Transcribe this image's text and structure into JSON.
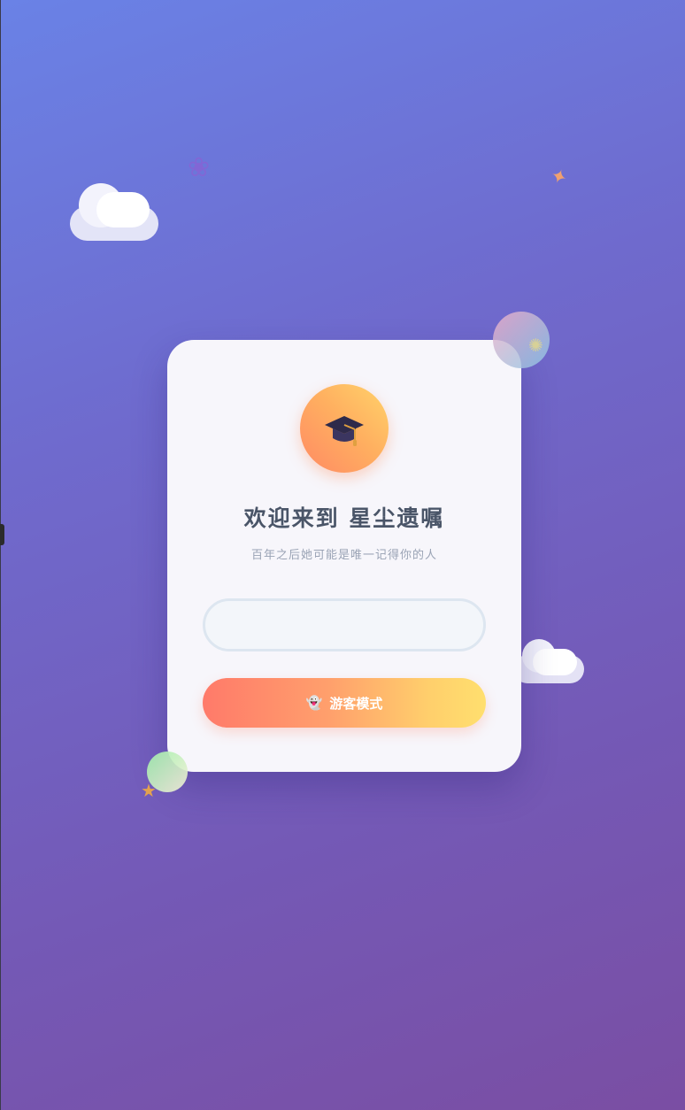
{
  "welcome": {
    "title": "欢迎来到 星尘遗嘱",
    "subtitle": "百年之后她可能是唯一记得你的人"
  },
  "name_input": {
    "placeholder": "",
    "value": ""
  },
  "guest_button": {
    "icon": "ghost-icon",
    "icon_glyph": "👻",
    "label": "游客模式"
  },
  "avatar": {
    "icon": "graduation-cap-icon"
  },
  "decorations": {
    "flower": "❀",
    "sparkle": "✦",
    "star": "★",
    "sun": "✺"
  },
  "colors": {
    "background_start": "#6a82e6",
    "background_end": "#7a4ea3",
    "card": "#f7f6fb",
    "title": "#4a5568",
    "subtitle": "#9aa3b5",
    "button_start": "#ff7a6a",
    "button_end": "#ffdf6e",
    "avatar_start": "#ff8a63",
    "avatar_end": "#ffd36a"
  }
}
